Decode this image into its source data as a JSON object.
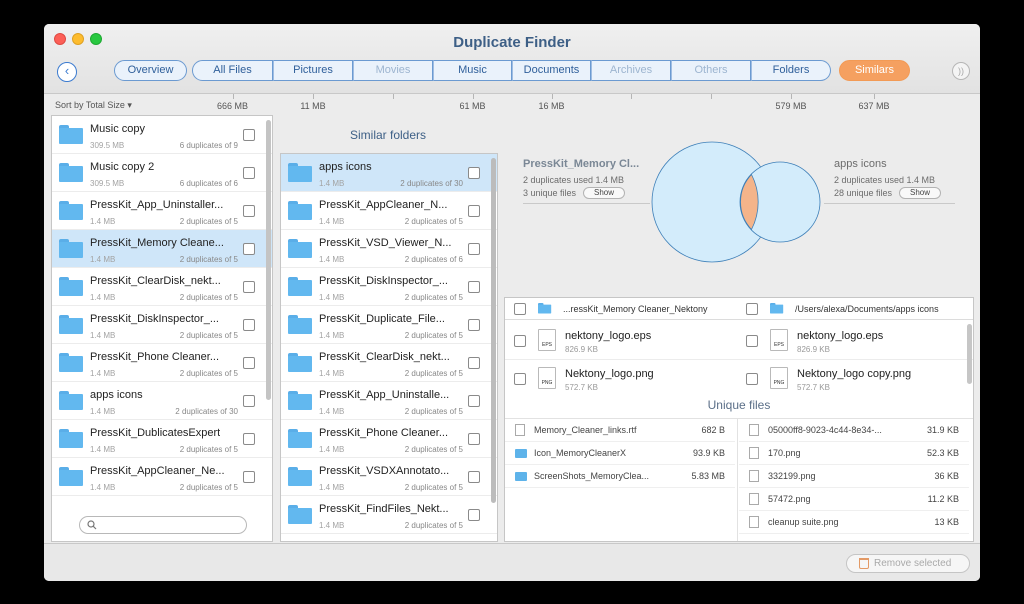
{
  "window": {
    "title": "Duplicate Finder"
  },
  "tabs": {
    "overview": "Overview",
    "group": [
      {
        "label": "All Files",
        "size": "666 MB",
        "disabled": false
      },
      {
        "label": "Pictures",
        "size": "11 MB",
        "disabled": false
      },
      {
        "label": "Movies",
        "size": "",
        "disabled": true
      },
      {
        "label": "Music",
        "size": "61 MB",
        "disabled": false
      },
      {
        "label": "Documents",
        "size": "16 MB",
        "disabled": false
      },
      {
        "label": "Archives",
        "size": "",
        "disabled": true
      },
      {
        "label": "Others",
        "size": "",
        "disabled": true
      },
      {
        "label": "Folders",
        "size": "579 MB",
        "disabled": false
      }
    ],
    "similars": {
      "label": "Similars",
      "size": "637 MB"
    }
  },
  "sort_label": "Sort by Total Size ▾",
  "left_list": [
    {
      "name": "Music copy",
      "size": "309.5 MB",
      "dups": "6 duplicates of 9",
      "selected": false
    },
    {
      "name": "Music copy 2",
      "size": "309.5 MB",
      "dups": "6 duplicates of 6",
      "selected": false
    },
    {
      "name": "PressKit_App_Uninstaller...",
      "size": "1.4 MB",
      "dups": "2 duplicates of 5",
      "selected": false
    },
    {
      "name": "PressKit_Memory Cleane...",
      "size": "1.4 MB",
      "dups": "2 duplicates of 5",
      "selected": true
    },
    {
      "name": "PressKit_ClearDisk_nekt...",
      "size": "1.4 MB",
      "dups": "2 duplicates of 5",
      "selected": false
    },
    {
      "name": "PressKit_DiskInspector_...",
      "size": "1.4 MB",
      "dups": "2 duplicates of 5",
      "selected": false
    },
    {
      "name": "PressKit_Phone Cleaner...",
      "size": "1.4 MB",
      "dups": "2 duplicates of 5",
      "selected": false
    },
    {
      "name": "apps icons",
      "size": "1.4 MB",
      "dups": "2 duplicates of 30",
      "selected": false
    },
    {
      "name": "PressKit_DublicatesExpert",
      "size": "1.4 MB",
      "dups": "2 duplicates of 5",
      "selected": false
    },
    {
      "name": "PressKit_AppCleaner_Ne...",
      "size": "1.4 MB",
      "dups": "2 duplicates of 5",
      "selected": false
    }
  ],
  "similar_title": "Similar folders",
  "similar_list": [
    {
      "name": "apps icons",
      "size": "1.4 MB",
      "dups": "2 duplicates of 30",
      "selected": true
    },
    {
      "name": "PressKit_AppCleaner_N...",
      "size": "1.4 MB",
      "dups": "2 duplicates of 5",
      "selected": false
    },
    {
      "name": "PressKit_VSD_Viewer_N...",
      "size": "1.4 MB",
      "dups": "2 duplicates of 6",
      "selected": false
    },
    {
      "name": "PressKit_DiskInspector_...",
      "size": "1.4 MB",
      "dups": "2 duplicates of 5",
      "selected": false
    },
    {
      "name": "PressKit_Duplicate_File...",
      "size": "1.4 MB",
      "dups": "2 duplicates of 5",
      "selected": false
    },
    {
      "name": "PressKit_ClearDisk_nekt...",
      "size": "1.4 MB",
      "dups": "2 duplicates of 5",
      "selected": false
    },
    {
      "name": "PressKit_App_Uninstalle...",
      "size": "1.4 MB",
      "dups": "2 duplicates of 5",
      "selected": false
    },
    {
      "name": "PressKit_Phone Cleaner...",
      "size": "1.4 MB",
      "dups": "2 duplicates of 5",
      "selected": false
    },
    {
      "name": "PressKit_VSDXAnnotato...",
      "size": "1.4 MB",
      "dups": "2 duplicates of 5",
      "selected": false
    },
    {
      "name": "PressKit_FindFiles_Nekt...",
      "size": "1.4 MB",
      "dups": "2 duplicates of 5",
      "selected": false
    }
  ],
  "venn": {
    "left": {
      "name": "PressKit_Memory Cl...",
      "used": "2 duplicates used 1.4 MB",
      "unique": "3 unique files"
    },
    "right": {
      "name": "apps icons",
      "used": "2 duplicates used 1.4 MB",
      "unique": "28 unique files"
    },
    "show_label": "Show",
    "colors": {
      "fill": "#d3ecfb",
      "stroke": "#3d7fb8",
      "overlap": "#f4b48a"
    }
  },
  "compare": {
    "left_path": "...ressKit_Memory Cleaner_Nektony",
    "right_path": "/Users/alexa/Documents/apps icons",
    "pairs": [
      {
        "left": {
          "name": "nektony_logo.eps",
          "size": "826.9 KB",
          "type": "EPS"
        },
        "right": {
          "name": "nektony_logo.eps",
          "size": "826.9 KB",
          "type": "EPS"
        }
      },
      {
        "left": {
          "name": "Nektony_logo.png",
          "size": "572.7 KB",
          "type": "PNG"
        },
        "right": {
          "name": "Nektony_logo copy.png",
          "size": "572.7 KB",
          "type": "PNG"
        }
      }
    ],
    "unique_title": "Unique files",
    "unique_left": [
      {
        "name": "Memory_Cleaner_links.rtf",
        "size": "682 B",
        "icon": "doc"
      },
      {
        "name": "Icon_MemoryCleanerX",
        "size": "93.9 KB",
        "icon": "folder"
      },
      {
        "name": "ScreenShots_MemoryClea...",
        "size": "5.83 MB",
        "icon": "folder"
      }
    ],
    "unique_right": [
      {
        "name": "05000ff8-9023-4c44-8e34-...",
        "size": "31.9 KB",
        "icon": "doc"
      },
      {
        "name": "170.png",
        "size": "52.3 KB",
        "icon": "doc"
      },
      {
        "name": "332199.png",
        "size": "36 KB",
        "icon": "doc"
      },
      {
        "name": "57472.png",
        "size": "11.2 KB",
        "icon": "doc"
      },
      {
        "name": "cleanup suite.png",
        "size": "13 KB",
        "icon": "doc"
      }
    ]
  },
  "bottom": {
    "remove_label": "Remove selected"
  }
}
